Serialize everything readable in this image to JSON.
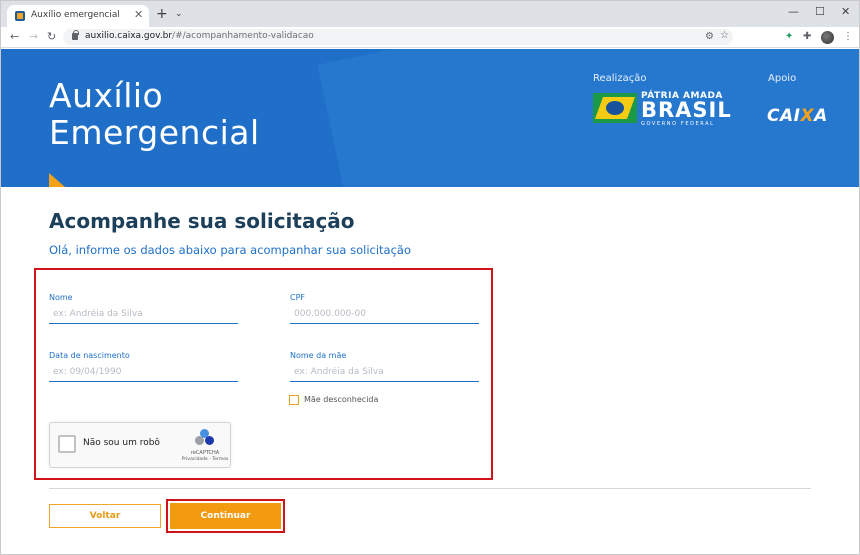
{
  "browser": {
    "tab_title": "Auxílio emergencial",
    "tab_close": "✕",
    "new_tab": "+",
    "tab_menu": "⌄",
    "url_host": "auxilio.caixa.gov.br",
    "url_path": "/#/acompanhamento-validacao",
    "minimize": "—",
    "maximize": "☐",
    "close": "✕",
    "menu": "⋮"
  },
  "hero": {
    "title_line1": "Auxílio",
    "title_line2": "Emergencial",
    "realizacao": "Realização",
    "apoio": "Apoio",
    "brasil_tagline": "PÁTRIA AMADA",
    "brasil": "BRASIL",
    "governo": "GOVERNO FEDERAL",
    "caixa_pre": "CAI",
    "caixa_x": "X",
    "caixa_post": "A"
  },
  "page": {
    "title": "Acompanhe sua solicitação",
    "subtitle": "Olá, informe os dados abaixo para acompanhar sua solicitação"
  },
  "form": {
    "nome_label": "Nome",
    "nome_placeholder": "ex: Andréia da Silva",
    "cpf_label": "CPF",
    "cpf_placeholder": "000.000.000-00",
    "nascimento_label": "Data de nascimento",
    "nascimento_placeholder": "ex: 09/04/1990",
    "mae_label": "Nome da mãe",
    "mae_placeholder": "ex: Andréia da Silva",
    "mae_desconhecida": "Mãe desconhecida"
  },
  "recaptcha": {
    "label": "Não sou um robô",
    "brand": "reCAPTCHA",
    "terms": "Privacidade - Termos"
  },
  "actions": {
    "voltar": "Voltar",
    "continuar": "Continuar"
  },
  "colors": {
    "hero_blue": "#1f6fc8",
    "accent_orange": "#f29a10",
    "title_navy": "#1c3f5a",
    "highlight_red": "#d0121b"
  }
}
